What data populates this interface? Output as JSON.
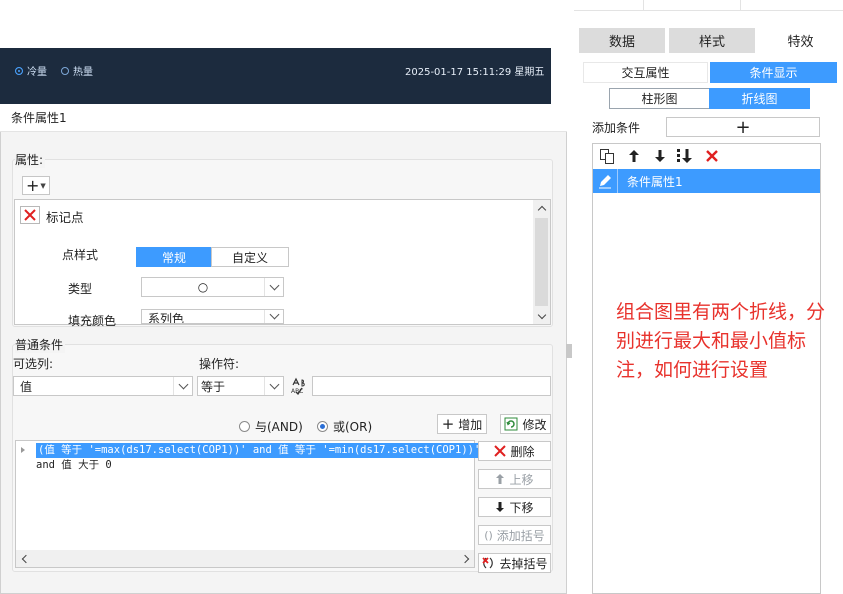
{
  "background_dashboard": {
    "radio_cold": "冷量",
    "radio_hot": "热量",
    "datetime": "2025-01-17  15:11:29  星期五"
  },
  "right_panel": {
    "tabs": [
      {
        "label": "数据",
        "active": false
      },
      {
        "label": "样式",
        "active": false
      },
      {
        "label": "特效",
        "active": true
      }
    ],
    "subtabs": [
      {
        "label": "交互属性",
        "active": false
      },
      {
        "label": "条件显示",
        "active": true
      }
    ],
    "chart_tabs": [
      {
        "label": "柱形图",
        "active": false
      },
      {
        "label": "折线图",
        "active": true
      }
    ],
    "add_condition_label": "添加条件",
    "add_condition_plus": "+",
    "toolbar_icons": [
      "copy-icon",
      "arrow-up-icon",
      "arrow-down-icon",
      "move-bottom-icon",
      "delete-icon"
    ],
    "conditions": [
      {
        "label": "条件属性1",
        "selected": true
      }
    ],
    "annotation": "组合图里有两个折线，分别进行最大和最小值标注，如何进行设置",
    "accent_color": "#3d9bff",
    "annotation_color": "#e8322c"
  },
  "dialog": {
    "title": "条件属性1",
    "attributes_label": "属性:",
    "add_plus": "+",
    "property": {
      "name": "标记点",
      "point_style_label": "点样式",
      "point_style_options": [
        {
          "label": "常规",
          "active": true
        },
        {
          "label": "自定义",
          "active": false
        }
      ],
      "type_label": "类型",
      "type_value": "○",
      "fill_color_label": "填充颜色",
      "fill_color_value": "系列色"
    },
    "common_condition": {
      "group_label": "普通条件",
      "optional_column_label": "可选列:",
      "optional_column_value": "值",
      "operator_label": "操作符:",
      "operator_value": "等于",
      "abc_icon_text": "ABC",
      "value_input": "",
      "radio_and": "与(AND)",
      "radio_or": "或(OR)",
      "radio_selected": "or",
      "add_button": "增加",
      "modify_button": "修改",
      "expressions": [
        "(值 等于 '=max(ds17.select(COP1))' and 值 等于 '=min(ds17.select(COP1))')",
        "and 值 大于 0"
      ],
      "side_buttons": {
        "delete": "删除",
        "move_up": "上移",
        "move_down": "下移",
        "add_bracket": "添加括号",
        "remove_bracket": "去掉括号"
      }
    }
  }
}
